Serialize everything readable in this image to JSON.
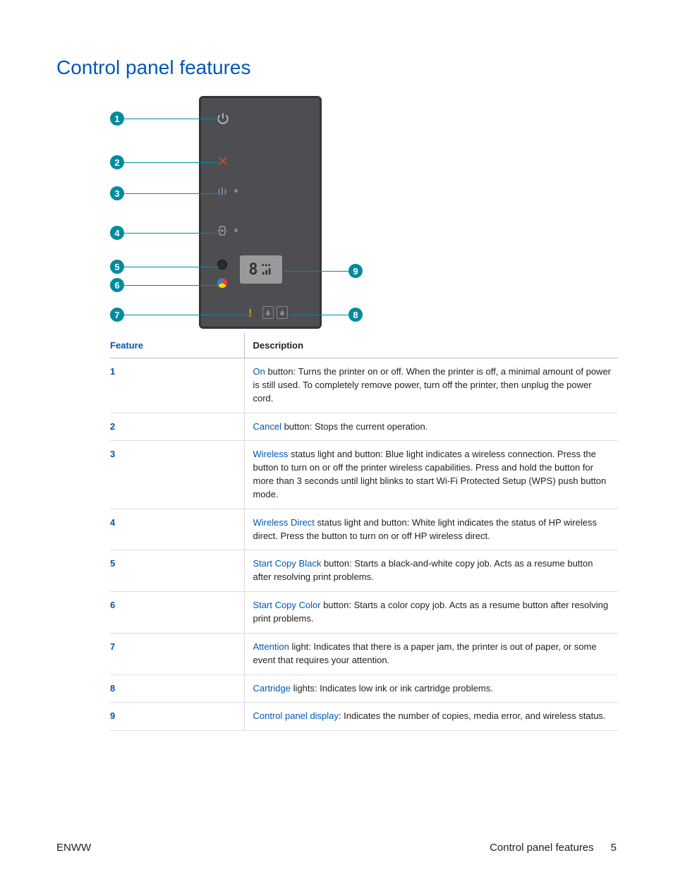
{
  "title": "Control panel features",
  "table": {
    "header_feature": "Feature",
    "header_description": "Description",
    "rows": [
      {
        "num": "1",
        "term": "On",
        "desc_rest": " button: Turns the printer on or off. When the printer is off, a minimal amount of power is still used. To completely remove power, turn off the printer, then unplug the power cord."
      },
      {
        "num": "2",
        "term": "Cancel",
        "desc_rest": " button: Stops the current operation."
      },
      {
        "num": "3",
        "term": "Wireless",
        "desc_rest": " status light and button: Blue light indicates a wireless connection. Press the button to turn on or off the printer wireless capabilities. Press and hold the button for more than 3 seconds until light blinks to start Wi-Fi Protected Setup (WPS) push button mode."
      },
      {
        "num": "4",
        "term": "Wireless Direct",
        "desc_rest": " status light and button: White light indicates the status of HP wireless direct. Press the button to turn on or off HP wireless direct."
      },
      {
        "num": "5",
        "term": "Start Copy Black",
        "desc_rest": " button: Starts a black-and-white copy job. Acts as a resume button after resolving print problems."
      },
      {
        "num": "6",
        "term": "Start Copy Color",
        "desc_rest": " button: Starts a color copy job. Acts as a resume button after resolving print problems."
      },
      {
        "num": "7",
        "term": "Attention",
        "desc_rest": " light: Indicates that there is a paper jam, the printer is out of paper, or some event that requires your attention."
      },
      {
        "num": "8",
        "term": "Cartridge",
        "desc_rest": " lights: Indicates low ink or ink cartridge problems."
      },
      {
        "num": "9",
        "term": "Control panel display",
        "desc_rest": ": Indicates the number of copies, media error, and wireless status."
      }
    ]
  },
  "callouts": {
    "c1": "1",
    "c2": "2",
    "c3": "3",
    "c4": "4",
    "c5": "5",
    "c6": "6",
    "c7": "7",
    "c8": "8",
    "c9": "9"
  },
  "display_digit": "8",
  "footer": {
    "left": "ENWW",
    "right_label": "Control panel features",
    "page": "5"
  }
}
